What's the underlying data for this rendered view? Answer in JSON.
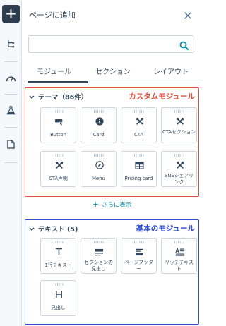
{
  "rail": {
    "items": [
      {
        "name": "add-icon"
      },
      {
        "name": "tree-icon"
      },
      {
        "name": "gauge-icon"
      },
      {
        "name": "flask-icon"
      },
      {
        "name": "document-icon"
      }
    ]
  },
  "panel": {
    "title": "ページに追加",
    "search": {
      "value": "",
      "placeholder": ""
    },
    "tabs": [
      {
        "label": "モジュール",
        "active": true
      },
      {
        "label": "セクション",
        "active": false
      },
      {
        "label": "レイアウト",
        "active": false
      }
    ]
  },
  "sections": {
    "theme": {
      "title": "テーマ（86件）",
      "annotation": "カスタムモジュール",
      "cards": [
        {
          "label": "Button",
          "icon": "button-icon"
        },
        {
          "label": "Card",
          "icon": "info-icon"
        },
        {
          "label": "CTA",
          "icon": "tools-icon"
        },
        {
          "label": "CTAセクション",
          "icon": "tools-icon"
        },
        {
          "label": "CTA声明",
          "icon": "tools-icon"
        },
        {
          "label": "Menu",
          "icon": "compass-icon"
        },
        {
          "label": "Pricing card",
          "icon": "table-icon"
        },
        {
          "label": "SNSシェアリンク",
          "icon": "tools-icon"
        }
      ],
      "show_more": "さらに表示"
    },
    "text": {
      "title": "テキスト (5)",
      "annotation": "基本のモジュール",
      "cards": [
        {
          "label": "1行テキスト",
          "icon": "text-t-icon"
        },
        {
          "label": "セクションの見出し",
          "icon": "section-heading-icon"
        },
        {
          "label": "ページフッター",
          "icon": "footer-icon"
        },
        {
          "label": "リッチテキスト",
          "icon": "rich-text-icon"
        },
        {
          "label": "見出し",
          "icon": "heading-h-icon"
        }
      ]
    }
  },
  "colors": {
    "accent_red": "#e8523d",
    "accent_blue": "#2b4fd8",
    "link": "#0091ae",
    "dark": "#2d3e50"
  }
}
